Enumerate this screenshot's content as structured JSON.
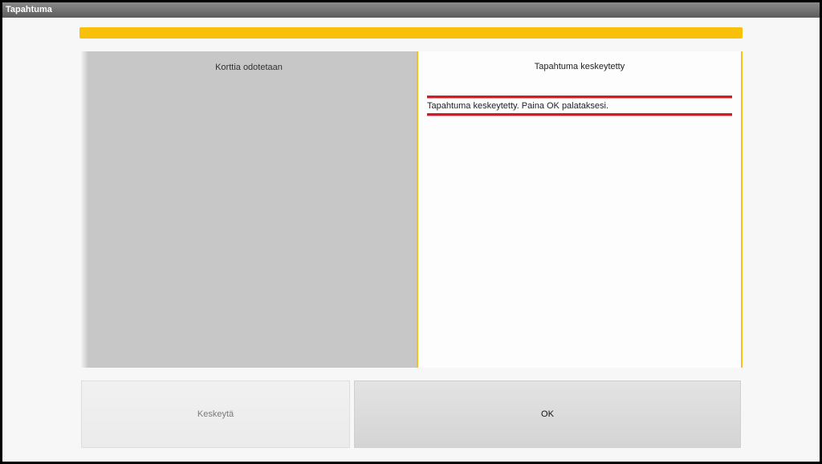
{
  "window": {
    "title": "Tapahtuma"
  },
  "progress": {
    "value": 1.0,
    "color": "#f8bf0b"
  },
  "left_panel": {
    "title": "Korttia odotetaan"
  },
  "right_panel": {
    "title": "Tapahtuma keskeytetty",
    "message": "Tapahtuma keskeytetty. Paina OK palataksesi."
  },
  "buttons": {
    "cancel_label": "Keskeytä",
    "ok_label": "OK"
  },
  "colors": {
    "accent": "#f5c11a",
    "error": "#d11b25"
  }
}
